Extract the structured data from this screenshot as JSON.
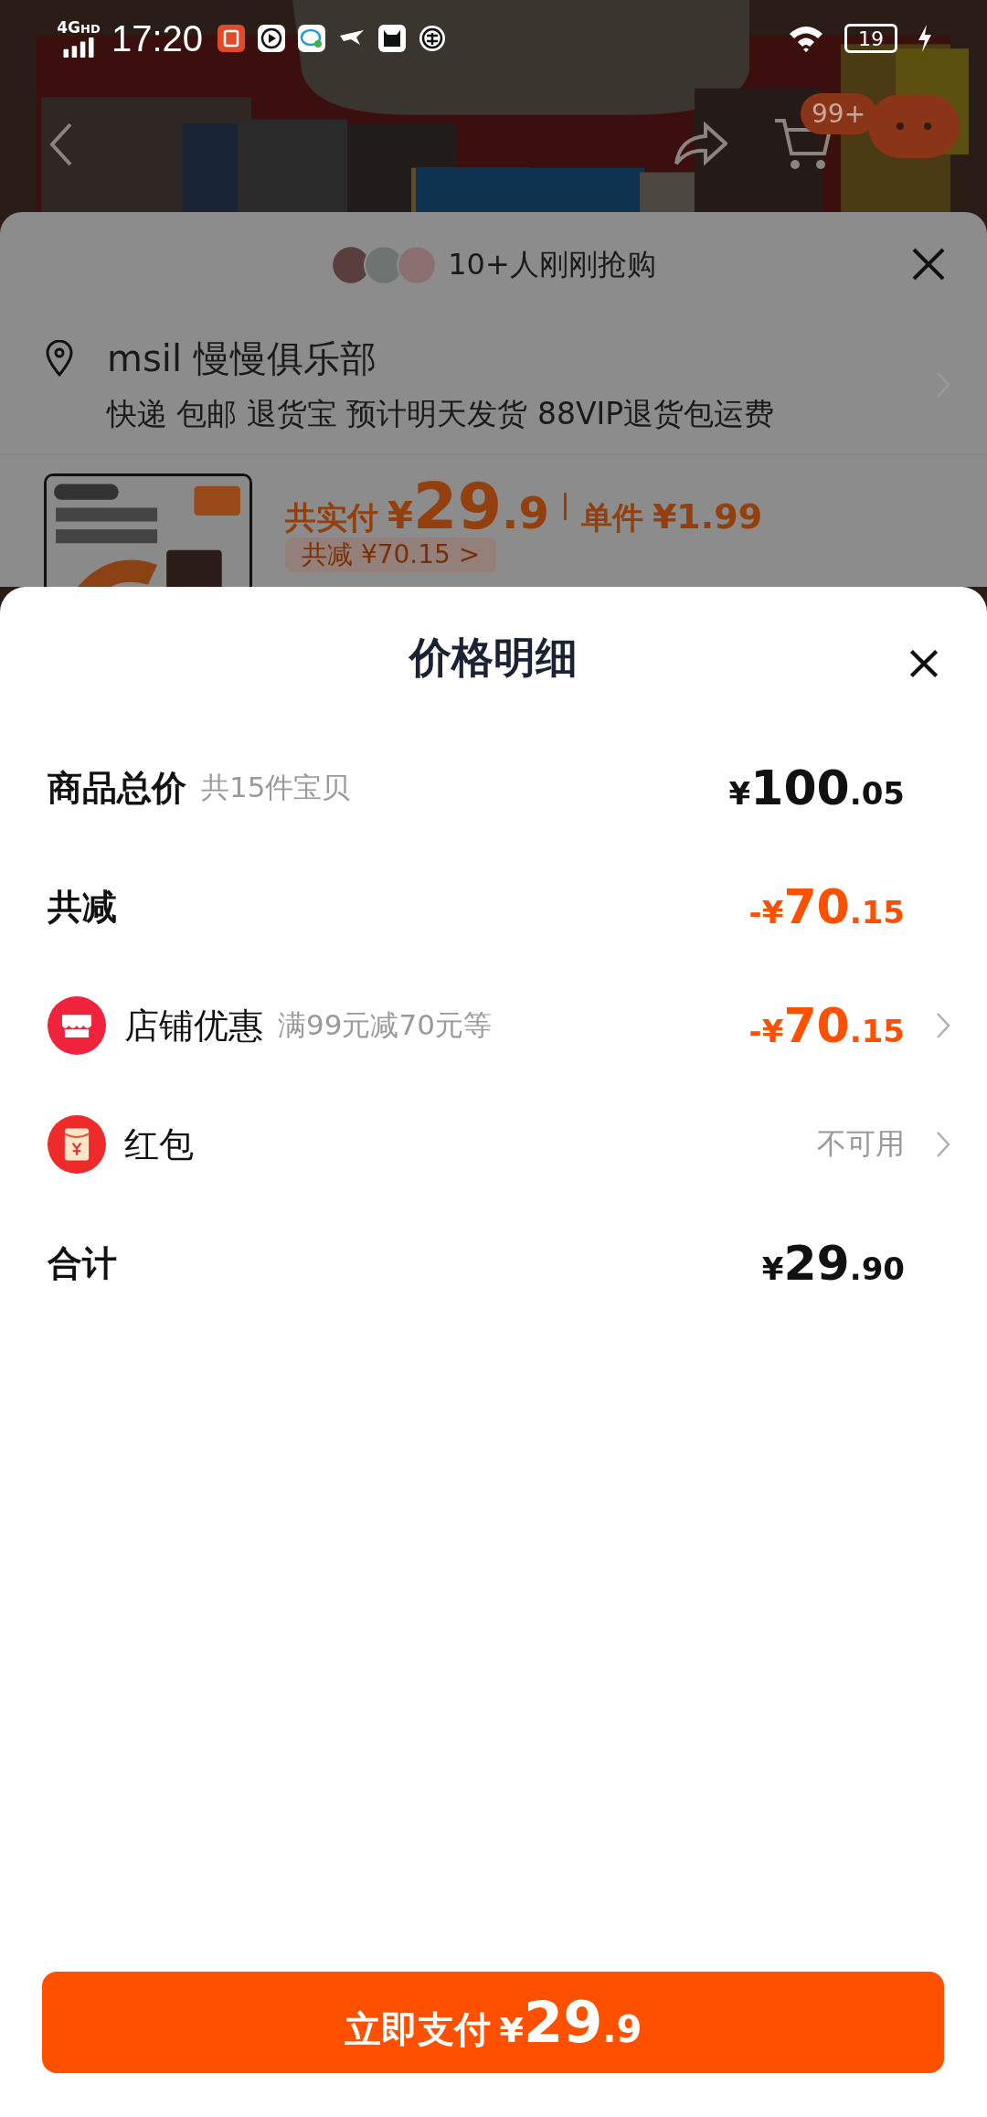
{
  "status_bar": {
    "network": "4G",
    "network_badge": "HD",
    "time": "17:20",
    "battery": "19"
  },
  "header": {
    "kind": "picture",
    "cart_badge": "99+"
  },
  "order_sheet": {
    "buyers_note": "10+人刚刚抢购",
    "address": "msil 慢慢俱乐部",
    "shipping_tags": "快递 包邮 退货宝 预计明天发货 88VIP退货包运费",
    "total_label": "共实付",
    "total_price": "¥29.9",
    "unit_label": "单件",
    "unit_price": "¥1.99",
    "discount_chip": "共减 ¥70.15 >"
  },
  "price_sheet": {
    "title": "价格明细",
    "rows": [
      {
        "kind": "subtotal",
        "label": "商品总价",
        "note": "共15件宝贝",
        "value": "¥100.05"
      },
      {
        "kind": "discount",
        "label": "共减",
        "value": "-¥70.15"
      },
      {
        "kind": "store_offer",
        "label": "店铺优惠",
        "note": "满99元减70元等",
        "value": "-¥70.15"
      },
      {
        "kind": "red_packet",
        "label": "红包",
        "value": "不可用"
      },
      {
        "kind": "total",
        "label": "合计",
        "value": "¥29.90"
      }
    ]
  },
  "pay_button": {
    "label": "立即支付",
    "price": "¥29.9"
  }
}
